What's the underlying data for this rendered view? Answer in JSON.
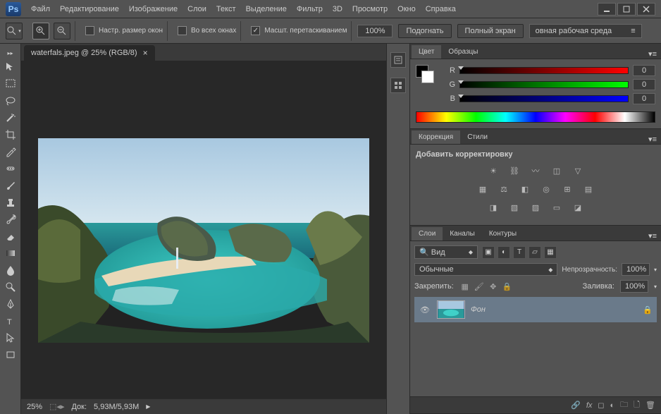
{
  "menu": {
    "items": [
      "Файл",
      "Редактирование",
      "Изображение",
      "Слои",
      "Текст",
      "Выделение",
      "Фильтр",
      "3D",
      "Просмотр",
      "Окно",
      "Справка"
    ]
  },
  "options": {
    "resize_windows": "Настр. размер окон",
    "all_windows": "Во всех окнах",
    "scrubby_zoom": "Масшт. перетаскиванием",
    "zoom_value": "100%",
    "fit_label": "Подогнать",
    "fullscreen_label": "Полный экран",
    "workspace": "овная рабочая среда"
  },
  "document": {
    "tab_title": "waterfals.jpeg @ 25% (RGB/8)",
    "status_zoom": "25%",
    "status_doc_label": "Док:",
    "status_doc_size": "5,93M/5,93M"
  },
  "panels": {
    "color": {
      "tab": "Цвет",
      "tab2": "Образцы",
      "r_label": "R",
      "r_value": "0",
      "g_label": "G",
      "g_value": "0",
      "b_label": "B",
      "b_value": "0",
      "fg": "#000000",
      "bg": "#ffffff"
    },
    "adjustments": {
      "tab": "Коррекция",
      "tab2": "Стили",
      "title": "Добавить корректировку"
    },
    "layers": {
      "tab": "Слои",
      "tab2": "Каналы",
      "tab3": "Контуры",
      "filter_kind": "Вид",
      "blend_mode": "Обычные",
      "opacity_label": "Непрозрачность:",
      "opacity_value": "100%",
      "lock_label": "Закрепить:",
      "fill_label": "Заливка:",
      "fill_value": "100%",
      "layer_name": "Фон"
    }
  }
}
